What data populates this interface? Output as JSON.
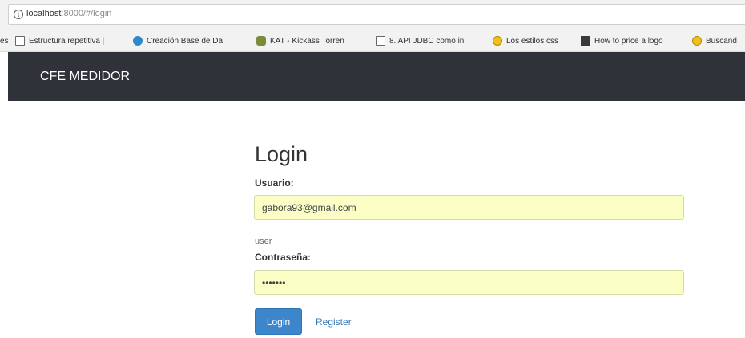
{
  "browser": {
    "url_host": "localhost",
    "url_rest": ":8000/#/login",
    "info_icon": "info-icon",
    "bookmarks": [
      {
        "label": "es",
        "icon": "none"
      },
      {
        "label": "Estructura repetitiva",
        "icon": "page-icon"
      },
      {
        "label": "Creación Base de Da",
        "icon": "wordpress-icon"
      },
      {
        "label": "KAT - Kickass Torren",
        "icon": "kat-icon"
      },
      {
        "label": "8. API JDBC como in",
        "icon": "page-icon"
      },
      {
        "label": "Los estilos css",
        "icon": "smiley-icon"
      },
      {
        "label": "How to price a logo",
        "icon": "pi-icon"
      },
      {
        "label": "Buscand",
        "icon": "smiley-icon"
      }
    ]
  },
  "navbar": {
    "brand": "CFE MEDIDOR",
    "background": "#2f3238"
  },
  "login": {
    "title": "Login",
    "username_label": "Usuario:",
    "username_value": "gabora93@gmail.com",
    "username_hint": "user",
    "password_label": "Contraseña:",
    "password_value": "•••••••",
    "submit_label": "Login",
    "register_label": "Register",
    "input_autofill_color": "#fbffc6",
    "button_color": "#3e86cc"
  }
}
